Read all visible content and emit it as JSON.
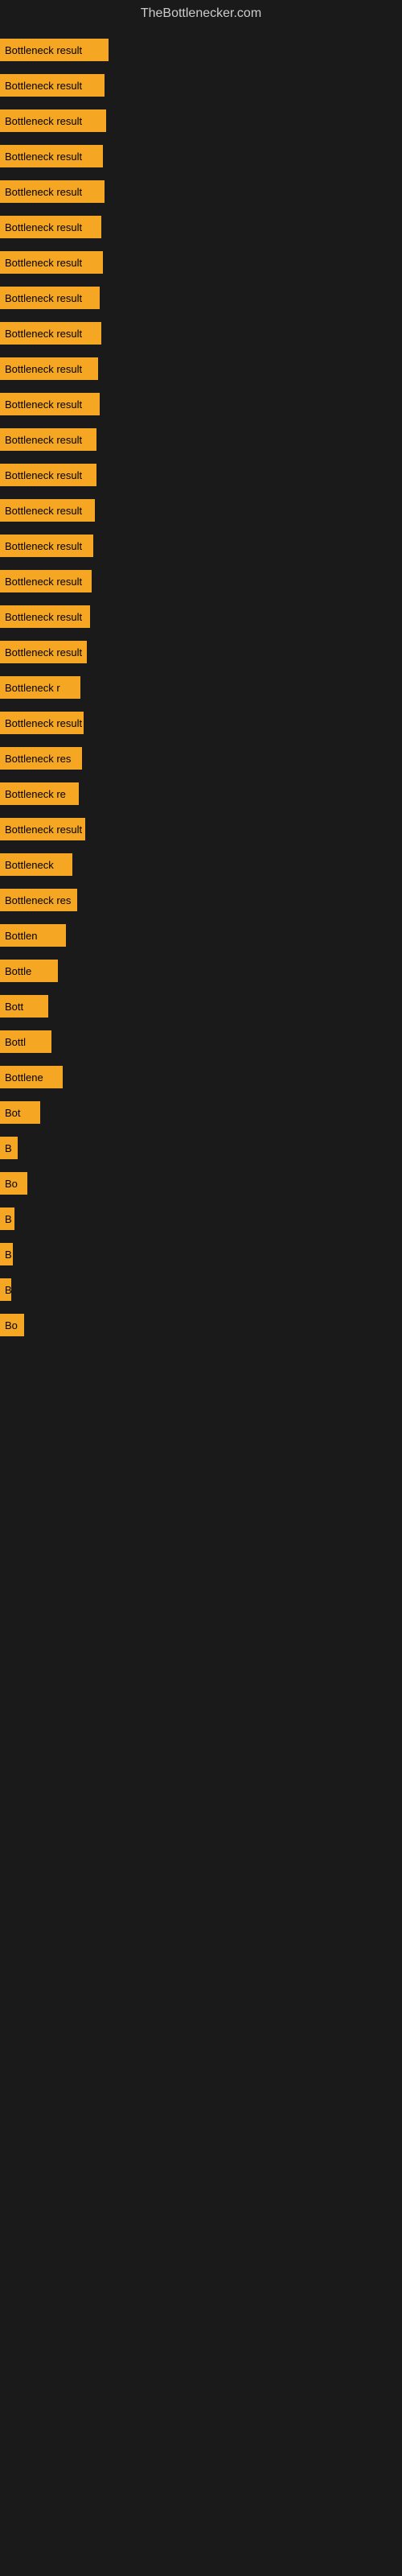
{
  "site": {
    "title": "TheBottlenecker.com"
  },
  "bars": [
    {
      "label": "Bottleneck result",
      "width": 135
    },
    {
      "label": "Bottleneck result",
      "width": 130
    },
    {
      "label": "Bottleneck result",
      "width": 132
    },
    {
      "label": "Bottleneck result",
      "width": 128
    },
    {
      "label": "Bottleneck result",
      "width": 130
    },
    {
      "label": "Bottleneck result",
      "width": 126
    },
    {
      "label": "Bottleneck result",
      "width": 128
    },
    {
      "label": "Bottleneck result",
      "width": 124
    },
    {
      "label": "Bottleneck result",
      "width": 126
    },
    {
      "label": "Bottleneck result",
      "width": 122
    },
    {
      "label": "Bottleneck result",
      "width": 124
    },
    {
      "label": "Bottleneck result",
      "width": 120
    },
    {
      "label": "Bottleneck result",
      "width": 120
    },
    {
      "label": "Bottleneck result",
      "width": 118
    },
    {
      "label": "Bottleneck result",
      "width": 116
    },
    {
      "label": "Bottleneck result",
      "width": 114
    },
    {
      "label": "Bottleneck result",
      "width": 112
    },
    {
      "label": "Bottleneck result",
      "width": 108
    },
    {
      "label": "Bottleneck r",
      "width": 100
    },
    {
      "label": "Bottleneck result",
      "width": 104
    },
    {
      "label": "Bottleneck res",
      "width": 102
    },
    {
      "label": "Bottleneck re",
      "width": 98
    },
    {
      "label": "Bottleneck result",
      "width": 106
    },
    {
      "label": "Bottleneck",
      "width": 90
    },
    {
      "label": "Bottleneck res",
      "width": 96
    },
    {
      "label": "Bottlen",
      "width": 82
    },
    {
      "label": "Bottle",
      "width": 72
    },
    {
      "label": "Bott",
      "width": 60
    },
    {
      "label": "Bottl",
      "width": 64
    },
    {
      "label": "Bottlene",
      "width": 78
    },
    {
      "label": "Bot",
      "width": 50
    },
    {
      "label": "B",
      "width": 22
    },
    {
      "label": "Bo",
      "width": 34
    },
    {
      "label": "B",
      "width": 18
    },
    {
      "label": "B",
      "width": 16
    },
    {
      "label": "B",
      "width": 14
    },
    {
      "label": "Bo",
      "width": 30
    }
  ]
}
